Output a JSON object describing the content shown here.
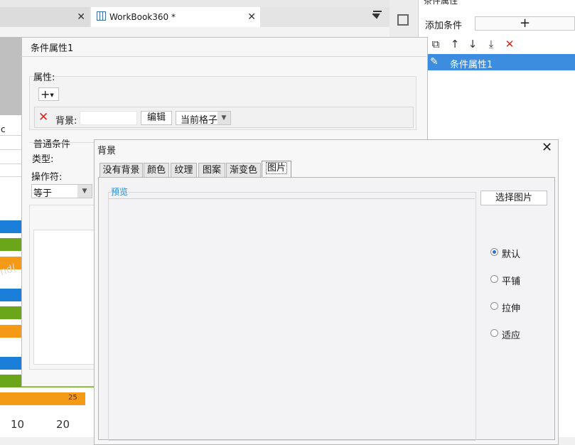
{
  "workbook": {
    "tab_label": "WorkBook360 *",
    "cell_c": "c",
    "chart": {
      "data_label": "25",
      "x_ticks": [
        "10",
        "20"
      ],
      "watermark": "nd("
    }
  },
  "conditions_panel": {
    "header": "条件属性",
    "add_label": "添加条件",
    "add_button": "+",
    "item_label": "条件属性1"
  },
  "condition_dialog": {
    "title": "条件属性1",
    "property_label": "属性:",
    "add_property_button": "+",
    "background_label": "背景:",
    "edit_button": "编辑",
    "scope_value": "当前格子",
    "common_conditions_label": "普通条件",
    "type_label": "类型:",
    "operator_label": "操作符:",
    "operator_value": "等于"
  },
  "background_dialog": {
    "title": "背景",
    "tabs": [
      "没有背景",
      "颜色",
      "纹理",
      "图案",
      "渐变色",
      "图片"
    ],
    "active_tab": "图片",
    "preview_label": "预览",
    "choose_image_button": "选择图片",
    "layout_options": [
      "默认",
      "平铺",
      "拉伸",
      "适应"
    ],
    "selected_layout": "默认"
  },
  "colors": {
    "selection_blue": "#3c8ce0",
    "bar_blue": "#1a7fd8",
    "bar_green": "#6aa51a",
    "bar_orange": "#f59a17",
    "delete_red": "#d9261c"
  }
}
